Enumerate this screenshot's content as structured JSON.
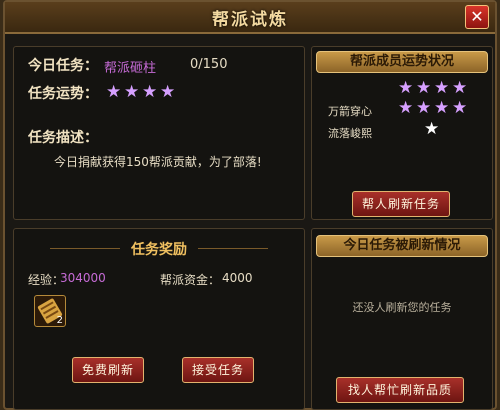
{
  "window": {
    "title": "帮派试炼"
  },
  "task": {
    "today_label": "今日任务：",
    "today_name": "帮派砸柱",
    "progress": "0/150",
    "fortune_label": "任务运势：",
    "fortune_stars": 4,
    "desc_label": "任务描述：",
    "desc_text": "今日捐献获得150帮派贡献，为了部落!"
  },
  "reward": {
    "header": "任务奖励",
    "exp_label": "经验：",
    "exp_value": "304000",
    "fund_label": "帮派资金：",
    "fund_value": "4000",
    "item_count": "2"
  },
  "buttons": {
    "free_refresh": "免费刷新",
    "accept": "接受任务",
    "help_refresh": "帮人刷新任务",
    "find_help": "找人帮忙刷新品质"
  },
  "members": {
    "banner": "帮派成员运势状况",
    "rows": [
      {
        "name": "",
        "stars": 4,
        "color": "#d6a0ff"
      },
      {
        "name": "万箭穿心",
        "stars": 4,
        "color": "#d6a0ff"
      },
      {
        "name": "流落峻熙",
        "stars": 1,
        "color": "#ffffff"
      }
    ]
  },
  "refresh": {
    "banner": "今日任务被刷新情况",
    "empty_text": "还没人刷新您的任务"
  }
}
